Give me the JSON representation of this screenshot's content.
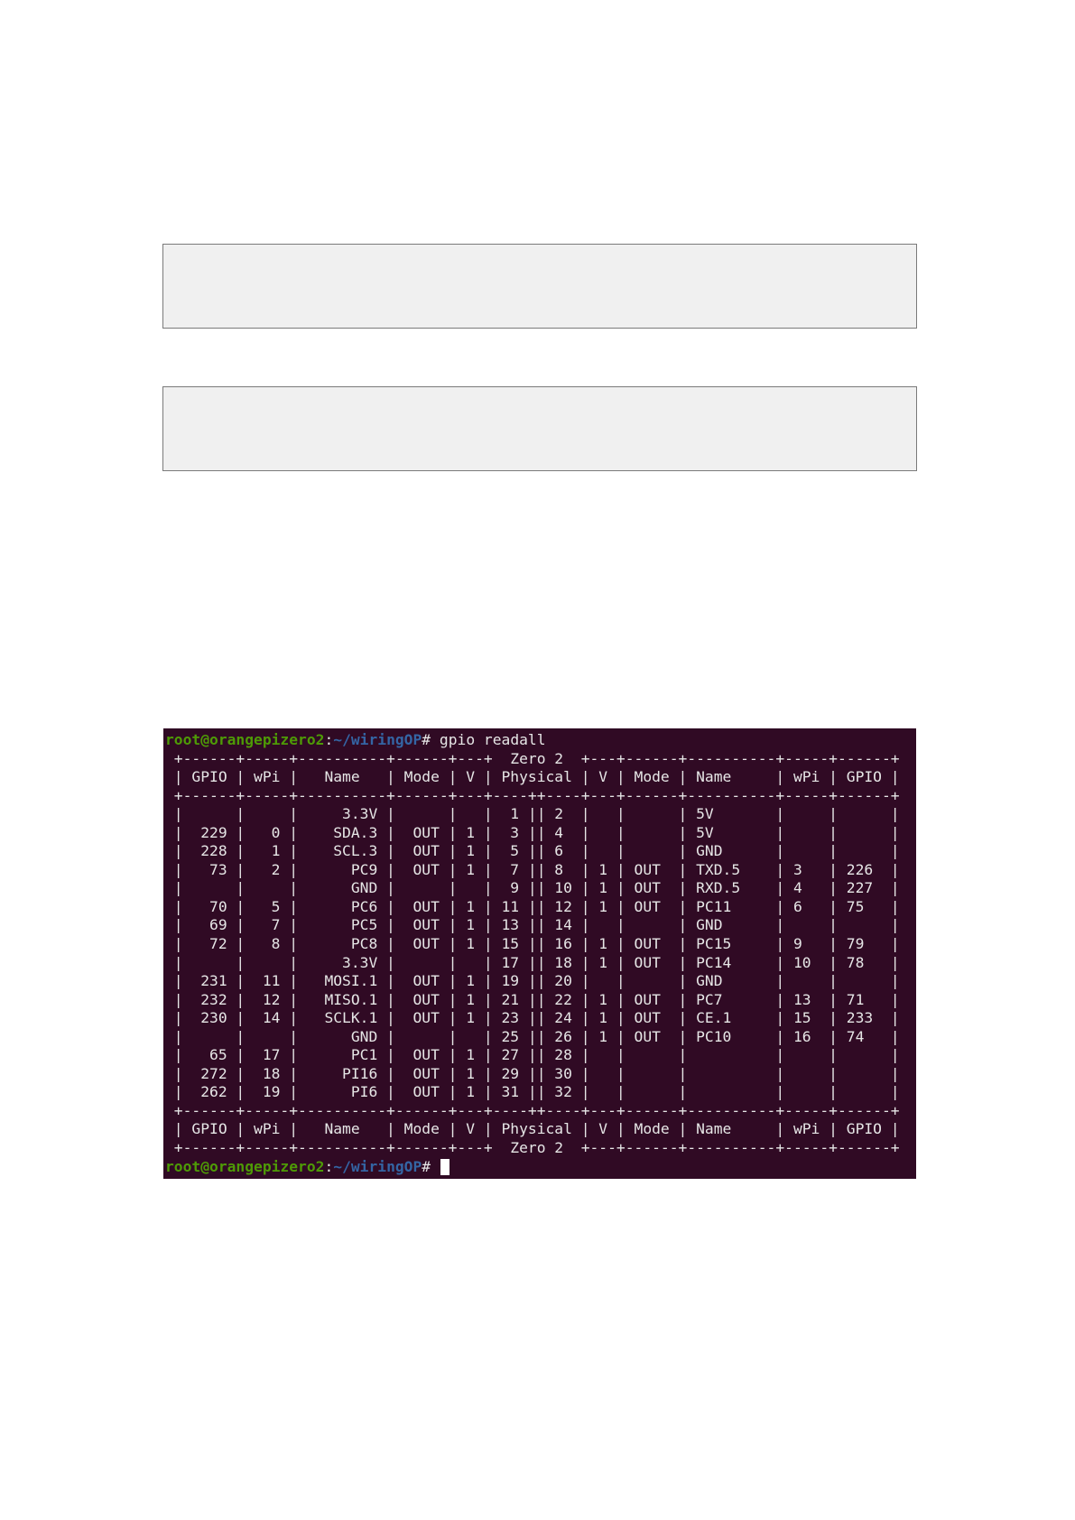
{
  "prompt": {
    "user_host": "root@orangepizero2",
    "separator": ":",
    "path": "~/wiringOP",
    "symbol": "#",
    "command": " gpio readall"
  },
  "terminal": {
    "header_border": " +------+-----+----------+------+---+  Zero 2  +---+------+----------+-----+------+",
    "header_columns": " | GPIO | wPi |   Name   | Mode | V | Physical | V | Mode | Name     | wPi | GPIO |",
    "divider": " +------+-----+----------+------+---+----++----+---+------+----------+-----+------+",
    "rows": [
      " |      |     |     3.3V |      |   |  1 || 2  |   |      | 5V       |     |      |",
      " |  229 |   0 |    SDA.3 |  OUT | 1 |  3 || 4  |   |      | 5V       |     |      |",
      " |  228 |   1 |    SCL.3 |  OUT | 1 |  5 || 6  |   |      | GND      |     |      |",
      " |   73 |   2 |      PC9 |  OUT | 1 |  7 || 8  | 1 | OUT  | TXD.5    | 3   | 226  |",
      " |      |     |      GND |      |   |  9 || 10 | 1 | OUT  | RXD.5    | 4   | 227  |",
      " |   70 |   5 |      PC6 |  OUT | 1 | 11 || 12 | 1 | OUT  | PC11     | 6   | 75   |",
      " |   69 |   7 |      PC5 |  OUT | 1 | 13 || 14 |   |      | GND      |     |      |",
      " |   72 |   8 |      PC8 |  OUT | 1 | 15 || 16 | 1 | OUT  | PC15     | 9   | 79   |",
      " |      |     |     3.3V |      |   | 17 || 18 | 1 | OUT  | PC14     | 10  | 78   |",
      " |  231 |  11 |   MOSI.1 |  OUT | 1 | 19 || 20 |   |      | GND      |     |      |",
      " |  232 |  12 |   MISO.1 |  OUT | 1 | 21 || 22 | 1 | OUT  | PC7      | 13  | 71   |",
      " |  230 |  14 |   SCLK.1 |  OUT | 1 | 23 || 24 | 1 | OUT  | CE.1     | 15  | 233  |",
      " |      |     |      GND |      |   | 25 || 26 | 1 | OUT  | PC10     | 16  | 74   |",
      " |   65 |  17 |      PC1 |  OUT | 1 | 27 || 28 |   |      |          |     |      |",
      " |  272 |  18 |     PI16 |  OUT | 1 | 29 || 30 |   |      |          |     |      |",
      " |  262 |  19 |      PI6 |  OUT | 1 | 31 || 32 |   |      |          |     |      |"
    ],
    "footer_columns": " | GPIO | wPi |   Name   | Mode | V | Physical | V | Mode | Name     | wPi | GPIO |",
    "footer_border": " +------+-----+----------+------+---+  Zero 2  +---+------+----------+-----+------+"
  }
}
